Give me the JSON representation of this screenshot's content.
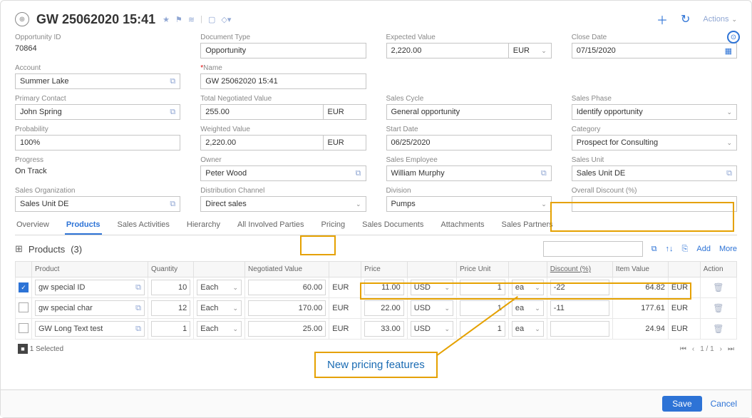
{
  "header": {
    "title": "GW 25062020 15:41",
    "actions_label": "Actions"
  },
  "form": {
    "opportunity_id": {
      "label": "Opportunity ID",
      "value": "70864"
    },
    "document_type": {
      "label": "Document Type",
      "value": "Opportunity"
    },
    "expected_value": {
      "label": "Expected Value",
      "value": "2,220.00",
      "currency": "EUR"
    },
    "close_date": {
      "label": "Close Date",
      "value": "07/15/2020"
    },
    "account": {
      "label": "Account",
      "value": "Summer Lake"
    },
    "name": {
      "label": "Name",
      "value": "GW 25062020 15:41",
      "required": true
    },
    "primary_contact": {
      "label": "Primary Contact",
      "value": "John Spring"
    },
    "total_negotiated_value": {
      "label": "Total Negotiated Value",
      "value": "255.00",
      "currency": "EUR"
    },
    "sales_cycle": {
      "label": "Sales Cycle",
      "value": "General opportunity"
    },
    "sales_phase": {
      "label": "Sales Phase",
      "value": "Identify opportunity"
    },
    "probability": {
      "label": "Probability",
      "value": "100%"
    },
    "weighted_value": {
      "label": "Weighted Value",
      "value": "2,220.00",
      "currency": "EUR"
    },
    "start_date": {
      "label": "Start Date",
      "value": "06/25/2020"
    },
    "category": {
      "label": "Category",
      "value": "Prospect for Consulting"
    },
    "progress": {
      "label": "Progress",
      "value": "On Track"
    },
    "owner": {
      "label": "Owner",
      "value": "Peter Wood"
    },
    "sales_employee": {
      "label": "Sales Employee",
      "value": "William Murphy"
    },
    "sales_unit": {
      "label": "Sales Unit",
      "value": "Sales Unit DE"
    },
    "sales_organization": {
      "label": "Sales Organization",
      "value": "Sales Unit DE"
    },
    "distribution_channel": {
      "label": "Distribution Channel",
      "value": "Direct sales"
    },
    "division": {
      "label": "Division",
      "value": "Pumps"
    },
    "overall_discount": {
      "label": "Overall Discount (%)",
      "value": ""
    }
  },
  "tabs": [
    "Overview",
    "Products",
    "Sales Activities",
    "Hierarchy",
    "All Involved Parties",
    "Pricing",
    "Sales Documents",
    "Attachments",
    "Sales Partners"
  ],
  "active_tab": "Products",
  "products": {
    "title": "Products",
    "count": "(3)",
    "add_label": "Add",
    "more_label": "More",
    "columns": [
      "",
      "Product",
      "Quantity",
      "",
      "Negotiated Value",
      "",
      "Price",
      "",
      "Price Unit",
      "",
      "Discount (%)",
      "Item Value",
      "",
      "Action"
    ],
    "rows": [
      {
        "checked": true,
        "product": "gw special ID",
        "qty": "10",
        "uom": "Each",
        "neg": "60.00",
        "negc": "EUR",
        "price": "11.00",
        "pricec": "USD",
        "pu": "1",
        "puu": "ea",
        "disc": "-22",
        "iv": "64.82",
        "ivc": "EUR"
      },
      {
        "checked": false,
        "product": "gw special char",
        "qty": "12",
        "uom": "Each",
        "neg": "170.00",
        "negc": "EUR",
        "price": "22.00",
        "pricec": "USD",
        "pu": "1",
        "puu": "ea",
        "disc": "-11",
        "iv": "177.61",
        "ivc": "EUR"
      },
      {
        "checked": false,
        "product": "GW Long Text test",
        "qty": "1",
        "uom": "Each",
        "neg": "25.00",
        "negc": "EUR",
        "price": "33.00",
        "pricec": "USD",
        "pu": "1",
        "puu": "ea",
        "disc": "",
        "iv": "24.94",
        "ivc": "EUR"
      }
    ],
    "selected_text": "1 Selected",
    "pager": "1 / 1"
  },
  "footer": {
    "save": "Save",
    "cancel": "Cancel"
  },
  "callout": {
    "text": "New pricing features"
  }
}
